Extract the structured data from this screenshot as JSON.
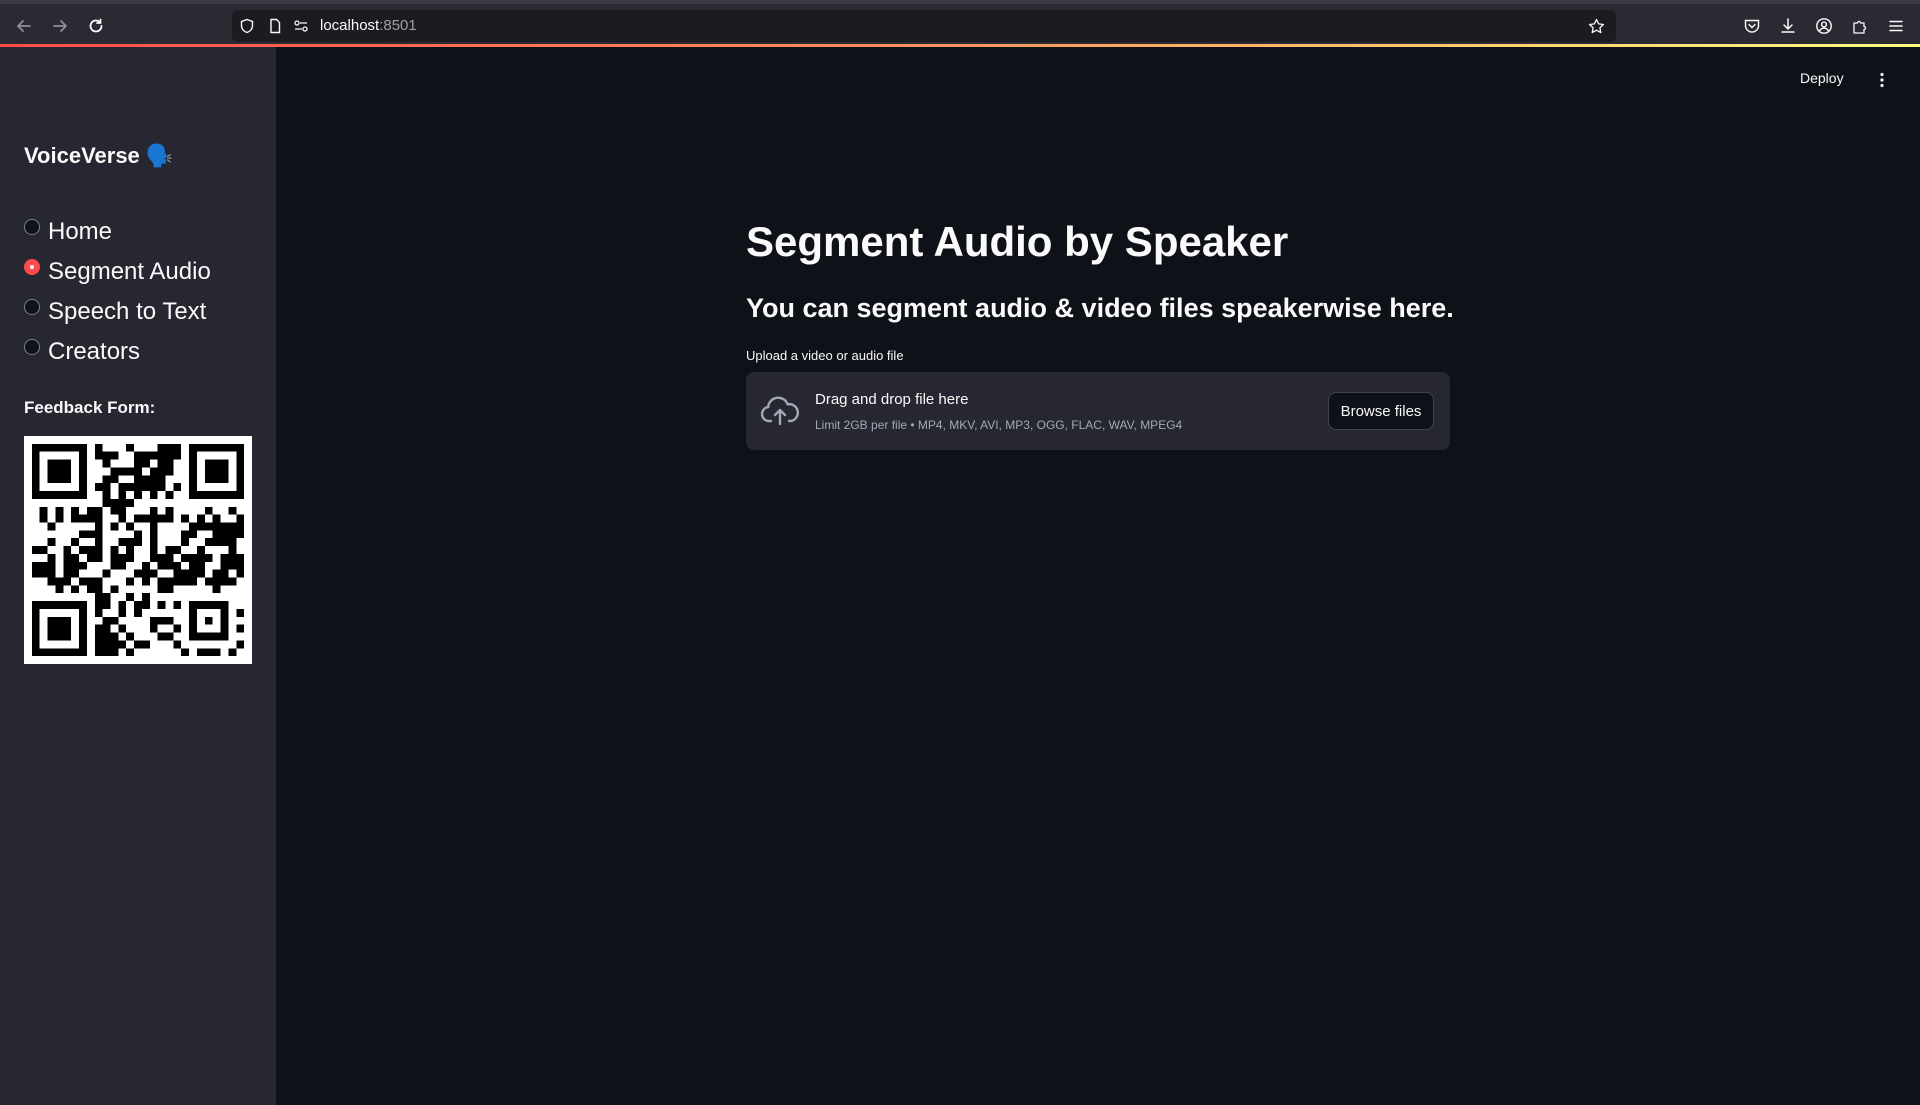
{
  "browser": {
    "url_host": "localhost",
    "url_port": ":8501"
  },
  "header": {
    "deploy_label": "Deploy"
  },
  "sidebar": {
    "app_title": "VoiceVerse",
    "app_emoji": "🗣️",
    "nav_items": [
      {
        "label": "Home",
        "selected": false
      },
      {
        "label": "Segment Audio",
        "selected": true
      },
      {
        "label": "Speech to Text",
        "selected": false
      },
      {
        "label": "Creators",
        "selected": false
      }
    ],
    "feedback_label": "Feedback Form:"
  },
  "main": {
    "title": "Segment Audio by Speaker",
    "subtitle": "You can segment audio & video files speakerwise here.",
    "uploader": {
      "label": "Upload a video or audio file",
      "drop_text": "Drag and drop file here",
      "limit_text": "Limit 2GB per file • MP4, MKV, AVI, MP3, OGG, FLAC, WAV, MPEG4",
      "browse_label": "Browse files"
    }
  },
  "colors": {
    "accent": "#ff4b4b",
    "background": "#0e1117",
    "sidebar": "#262730"
  }
}
